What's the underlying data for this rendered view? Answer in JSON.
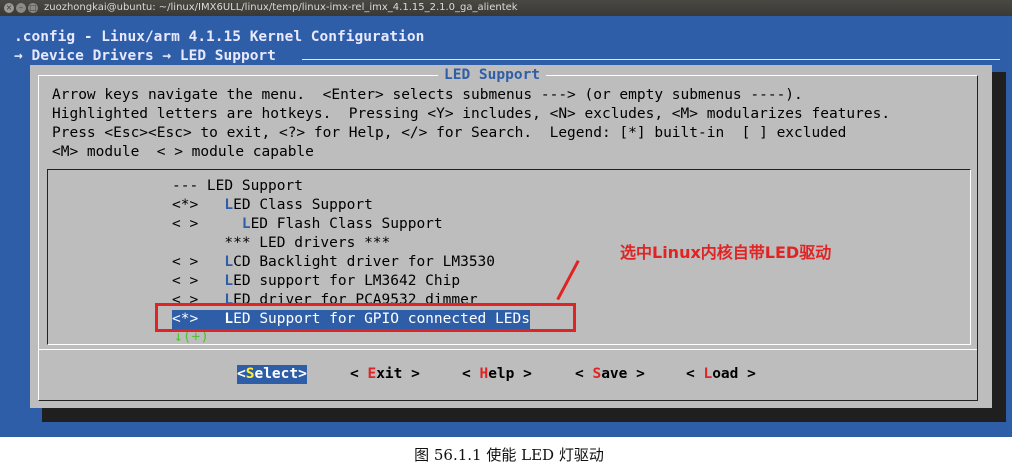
{
  "window": {
    "title": "zuozhongkai@ubuntu: ~/linux/IMX6ULL/linux/temp/linux-imx-rel_imx_4.1.15_2.1.0_ga_alientek"
  },
  "header": {
    "config_line": ".config - Linux/arm 4.1.15 Kernel Configuration",
    "breadcrumb": "→ Device Drivers → LED Support"
  },
  "dialog": {
    "title": "LED Support",
    "help_lines": [
      "Arrow keys navigate the menu.  <Enter> selects submenus ---> (or empty submenus ----).",
      "Highlighted letters are hotkeys.  Pressing <Y> includes, <N> excludes, <M> modularizes features.",
      "Press <Esc><Esc> to exit, <?> for Help, </> for Search.  Legend: [*] built-in  [ ] excluded",
      "<M> module  < > module capable"
    ]
  },
  "menu": {
    "items": [
      {
        "prefix": "--- ",
        "hotkey": "",
        "text": "LED Support"
      },
      {
        "prefix": "<*>   ",
        "hotkey": "L",
        "text": "ED Class Support"
      },
      {
        "prefix": "< >     ",
        "hotkey": "L",
        "text": "ED Flash Class Support"
      },
      {
        "prefix": "      ",
        "hotkey": "",
        "text": "*** LED drivers ***"
      },
      {
        "prefix": "< >   ",
        "hotkey": "L",
        "text": "CD Backlight driver for LM3530"
      },
      {
        "prefix": "< >   ",
        "hotkey": "L",
        "text": "ED support for LM3642 Chip"
      },
      {
        "prefix": "< >   ",
        "hotkey": "L",
        "text": "ED driver for PCA9532 dimmer"
      },
      {
        "prefix": "<*>   ",
        "hotkey": "L",
        "text": "ED Support for GPIO connected LEDs"
      }
    ],
    "more_indicator": "↓(+)"
  },
  "annotation": {
    "text": "选中Linux内核自带LED驱动"
  },
  "buttons": {
    "select": {
      "pre": "<",
      "hotkey": "S",
      "rest": "elect>"
    },
    "exit": {
      "pre": "< ",
      "hotkey": "E",
      "rest": "xit >"
    },
    "help": {
      "pre": "< ",
      "hotkey": "H",
      "rest": "elp >"
    },
    "save": {
      "pre": "< ",
      "hotkey": "S",
      "rest": "ave >"
    },
    "load": {
      "pre": "< ",
      "hotkey": "L",
      "rest": "oad >"
    }
  },
  "caption": "图 56.1.1 使能 LED 灯驱动",
  "colors": {
    "terminal_bg": "#2f5ea8",
    "dialog_bg": "#bdbdbd",
    "highlight": "#2f5ea8",
    "annotation": "#e02424"
  }
}
